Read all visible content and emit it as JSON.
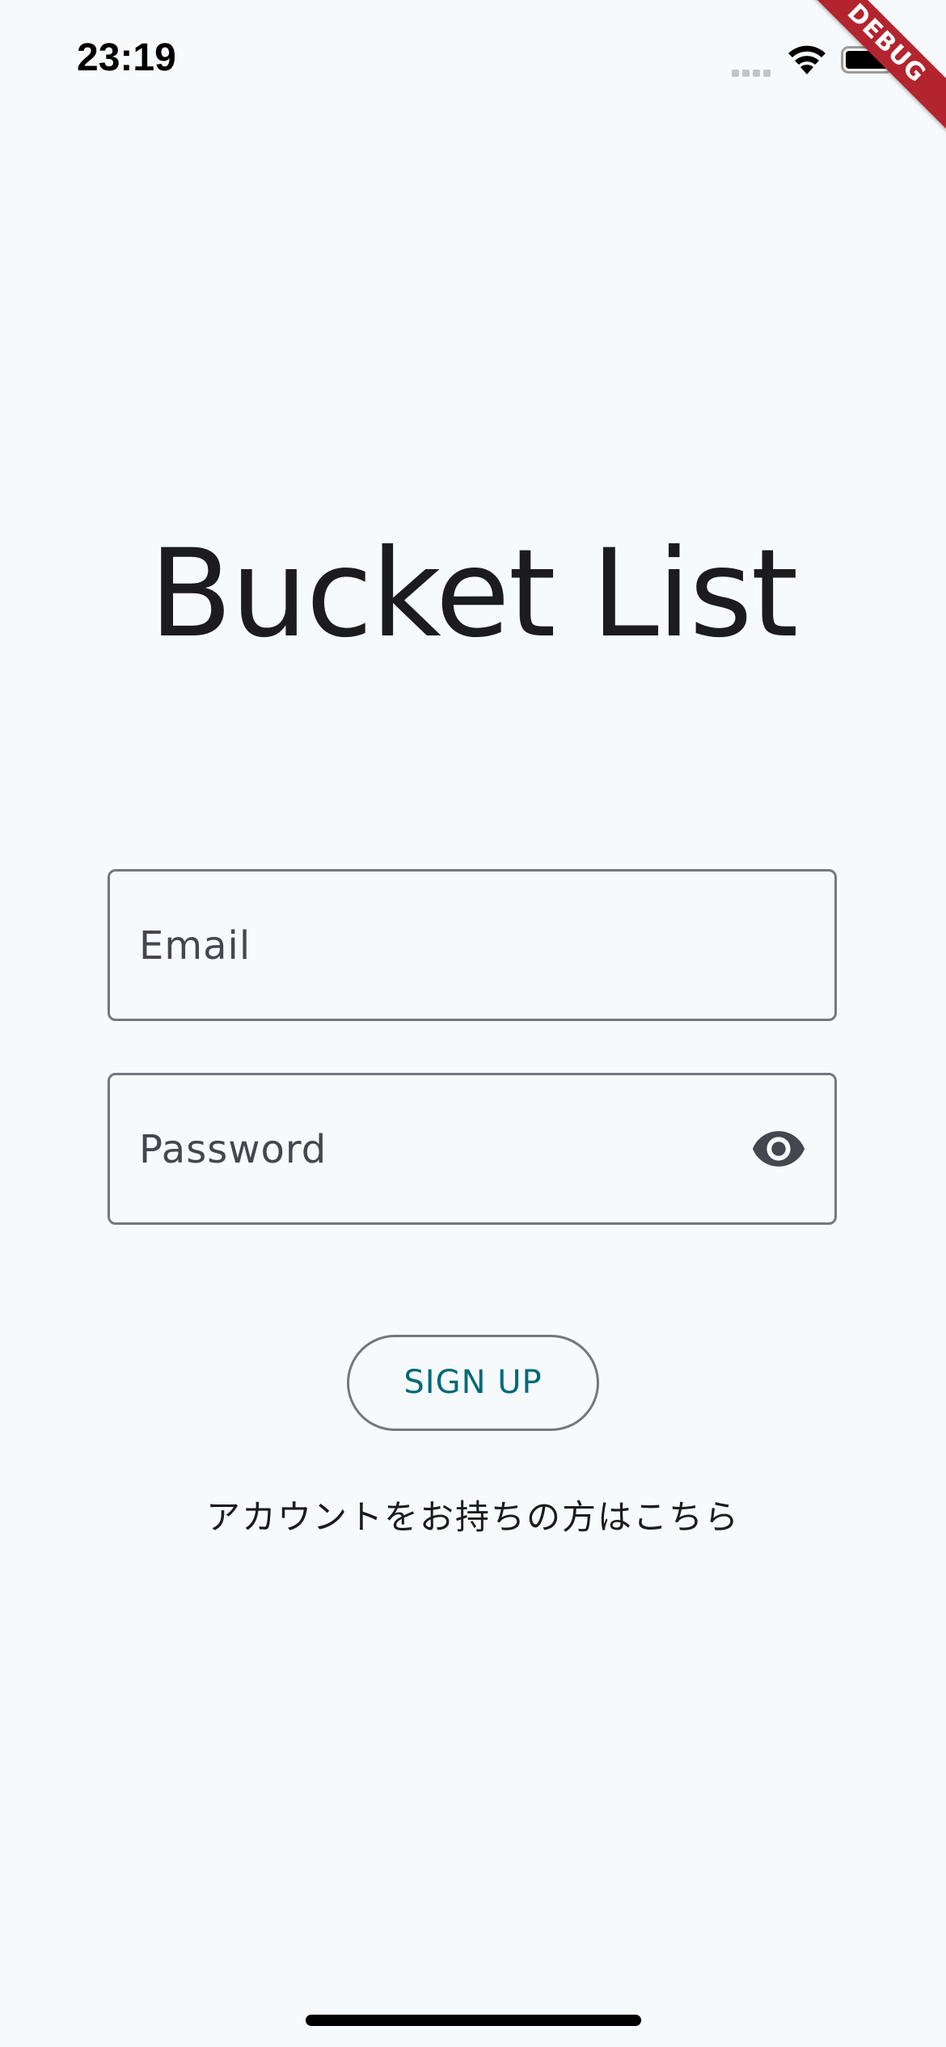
{
  "status_bar": {
    "time": "23:19",
    "signal_icon": "signal-dots-icon",
    "wifi_icon": "wifi-icon",
    "battery_icon": "battery-full-icon"
  },
  "debug_banner": {
    "label": "DEBUG",
    "color": "#b3242e"
  },
  "app": {
    "title": "Bucket List"
  },
  "form": {
    "email": {
      "value": "",
      "placeholder": "Email"
    },
    "password": {
      "value": "",
      "placeholder": "Password",
      "visibility_icon": "eye-icon"
    },
    "signup_label": "SIGN UP",
    "account_link": "アカウントをお持ちの方はこちら"
  },
  "colors": {
    "background": "#f6fafc",
    "accent": "#006a78",
    "outline": "#74777f",
    "text": "#1c1b1f"
  }
}
